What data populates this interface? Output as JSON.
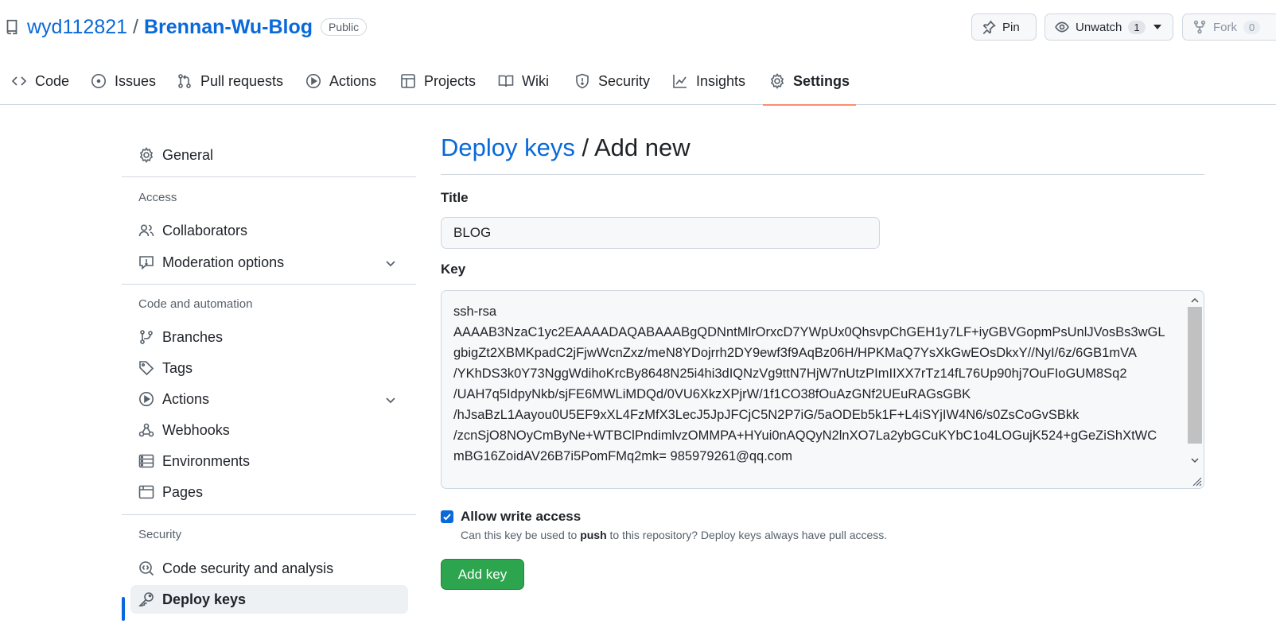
{
  "repo": {
    "owner": "wyd112821",
    "separator": "/",
    "name": "Brennan-Wu-Blog",
    "visibility": "Public",
    "repo_icon": "repo-icon"
  },
  "header_actions": {
    "pin_label": "Pin",
    "unwatch_label": "Unwatch",
    "watch_count": "1",
    "fork_label": "Fork",
    "fork_count": "0"
  },
  "tabs": [
    {
      "label": "Code",
      "icon": "code-icon"
    },
    {
      "label": "Issues",
      "icon": "issue-opened-icon"
    },
    {
      "label": "Pull requests",
      "icon": "git-pull-request-icon"
    },
    {
      "label": "Actions",
      "icon": "play-icon"
    },
    {
      "label": "Projects",
      "icon": "table-icon"
    },
    {
      "label": "Wiki",
      "icon": "book-icon"
    },
    {
      "label": "Security",
      "icon": "shield-icon"
    },
    {
      "label": "Insights",
      "icon": "graph-icon"
    },
    {
      "label": "Settings",
      "icon": "gear-icon",
      "selected": true
    }
  ],
  "sidebar": {
    "general": "General",
    "access_heading": "Access",
    "collaborators": "Collaborators",
    "moderation": "Moderation options",
    "code_automation_heading": "Code and automation",
    "branches": "Branches",
    "tags": "Tags",
    "actions": "Actions",
    "webhooks": "Webhooks",
    "environments": "Environments",
    "pages": "Pages",
    "security_heading": "Security",
    "code_security": "Code security and analysis",
    "deploy_keys": "Deploy keys"
  },
  "main": {
    "breadcrumb": "Deploy keys",
    "heading_sep": " / ",
    "heading": "Add new",
    "title_label": "Title",
    "title_value": "BLOG",
    "key_label": "Key",
    "key_value": "ssh-rsa\nAAAAB3NzaC1yc2EAAAADAQABAAABgQDNntMlrOrxcD7YWpUx0QhsvpChGEH1y7LF+iyGBVGopmPsUnlJVosBs3wGL\ngbigZt2XBMKpadC2jFjwWcnZxz/meN8YDojrrh2DY9ewf3f9AqBz06H/HPKMaQ7YsXkGwEOsDkxY//NyI/6z/6GB1mVA\n/YKhDS3k0Y73NggWdihoKrcBy8648N25i4hi3dIQNzVg9ttN7HjW7nUtzPImIIXX7rTz14fL76Up90hj7OuFIoGUM8Sq2\n/UAH7q5IdpyNkb/sjFE6MWLiMDQd/0VU6XkzXPjrW/1f1CO38fOuAzGNf2UEuRAGsGBK\n/hJsaBzL1Aayou0U5EF9xXL4FzMfX3LecJ5JpJFCjC5N2P7iG/5aODEb5k1F+L4iSYjIW4N6/s0ZsCoGvSBkk\n/zcnSjO8NOyCmByNe+WTBClPndimlvzOMMPA+HYui0nAQQyN2lnXO7La2ybGCuKYbC1o4LOGujK524+gGeZiShXtWC\nmBG16ZoidAV26B7i5PomFMq2mk= 985979261@qq.com",
    "allow_write_label": "Allow write access",
    "allow_write_checked": true,
    "note_before": "Can this key be used to ",
    "note_bold": "push",
    "note_after": " to this repository? Deploy keys always have pull access.",
    "submit_label": "Add key"
  },
  "colors": {
    "link": "#0969da",
    "primary_button": "#2da44e",
    "selected_tab_underline": "#fd8c73",
    "active_sidebar_bar": "#0969da"
  }
}
